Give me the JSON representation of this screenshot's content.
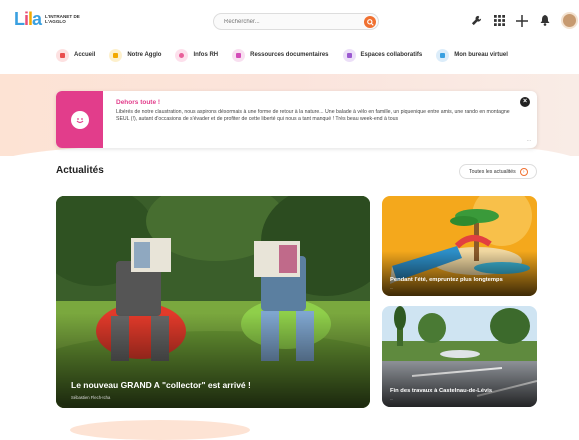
{
  "brand": {
    "logo": "Lila",
    "tagline": "L'INTRANET DE L'AGGLO"
  },
  "search": {
    "placeholder": "Rechercher..."
  },
  "header_icons": [
    "wrench-icon",
    "grid-icon",
    "plus-icon",
    "bell-icon"
  ],
  "nav": {
    "items": [
      {
        "label": "Accueil",
        "color": "#e94e4e"
      },
      {
        "label": "Notre Agglo",
        "color": "#f2a900"
      },
      {
        "label": "Infos RH",
        "color": "#e8609a"
      },
      {
        "label": "Ressources documentaires",
        "color": "#d34bb8"
      },
      {
        "label": "Espaces collaboratifs",
        "color": "#9b59d0"
      },
      {
        "label": "Mon bureau virtuel",
        "color": "#3aa0e0"
      }
    ]
  },
  "alert": {
    "title": "Dehors toute !",
    "text": "Libérés de notre claustration, nous aspirons désormais à une forme de retour à la nature... Une balade à vélo en famille, un piquenique entre amis, une rando en montagne SEUL (!), autant d'occasions de s'évader et de profiter de cette liberté qui nous a tant manqué ! Très beau week-end à tous",
    "more": "..."
  },
  "news": {
    "title": "Actualités",
    "all_label": "Toutes les actualités",
    "main": {
      "title": "Le nouveau GRAND A \"collector\" est arrivé !",
      "sub": "Sébastien Flech-Icha"
    },
    "side1": {
      "title": "Pendant l'été, empruntez plus longtemps",
      "sub": "..."
    },
    "side2": {
      "title": "Fin des travaux à Castelnau-de-Lévis",
      "sub": "..."
    }
  },
  "colors": {
    "accent": "#f07030",
    "alert": "#e23d8b"
  }
}
